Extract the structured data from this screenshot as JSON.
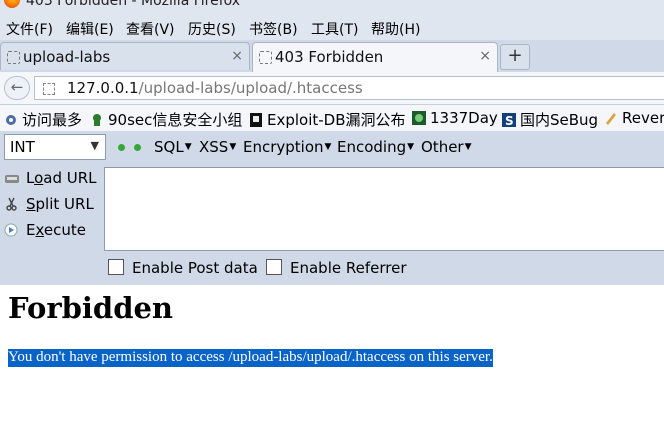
{
  "window": {
    "title": "403 Forbidden - Mozilla Firefox"
  },
  "menu": {
    "file": "文件(F)",
    "edit": "编辑(E)",
    "view": "查看(V)",
    "history": "历史(S)",
    "bookmarks": "书签(B)",
    "tools": "工具(T)",
    "help": "帮助(H)"
  },
  "tabs": [
    {
      "label": "upload-labs",
      "close": "×"
    },
    {
      "label": "403 Forbidden",
      "close": "×"
    }
  ],
  "new_tab": "+",
  "address": {
    "domain": "127.0.0.1",
    "path": "/upload-labs/upload/.htaccess"
  },
  "bookmarks": [
    {
      "label": "访问最多",
      "icon": "gear-icon"
    },
    {
      "label": "90sec信息安全小组",
      "icon": "ninja-icon"
    },
    {
      "label": "Exploit-DB漏洞公布",
      "icon": "exploit-db-icon"
    },
    {
      "label": "1337Day",
      "icon": "1337day-icon"
    },
    {
      "label": "国内SeBug",
      "icon": "sebug-icon"
    },
    {
      "label": "Rever",
      "icon": "pen-icon"
    }
  ],
  "hackbar": {
    "select_value": "INT",
    "menus": [
      "SQL",
      "XSS",
      "Encryption",
      "Encoding",
      "Other"
    ],
    "load_url": {
      "u": "o",
      "pre": "L",
      "post": "ad URL"
    },
    "split_url": {
      "u": "S",
      "pre": "",
      "post": "plit URL"
    },
    "execute": {
      "u": "x",
      "pre": "E",
      "post": "ecute"
    },
    "enable_post": "Enable Post data",
    "enable_referrer": "Enable Referrer",
    "url_text": ""
  },
  "page": {
    "heading": "Forbidden",
    "message": "You don't have permission to access /upload-labs/upload/.htaccess on this server."
  }
}
